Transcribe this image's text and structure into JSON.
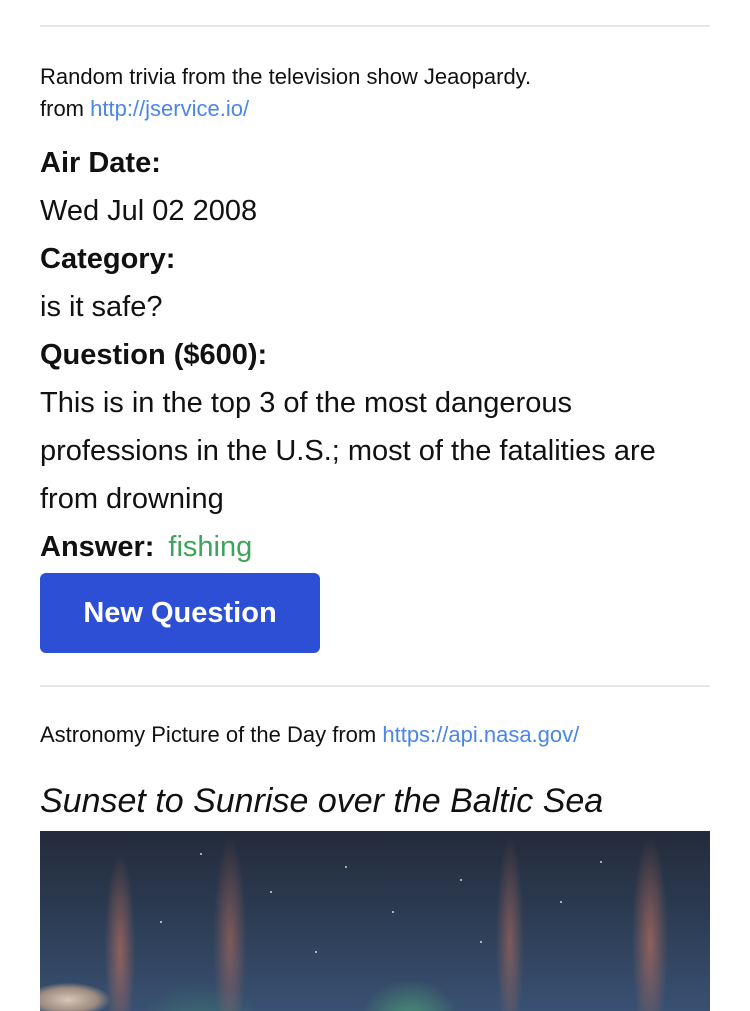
{
  "trivia": {
    "intro": "Random trivia from the television show Jeaopardy.",
    "from_label": "from",
    "source_link": "http://jservice.io/",
    "air_date_label": "Air Date:",
    "air_date": "Wed Jul 02 2008",
    "category_label": "Category:",
    "category": "is it safe?",
    "question_label": "Question ($600):",
    "question": "This is in the top 3 of the most dangerous professions in the U.S.; most of the fatalities are from drowning",
    "answer_label": "Answer:",
    "answer": "fishing",
    "new_question_button": "New Question"
  },
  "apod": {
    "source_text": "Astronomy Picture of the Day from",
    "source_link": "https://api.nasa.gov/",
    "title": "Sunset to Sunrise over the Baltic Sea",
    "image_description": "aurora-photo"
  },
  "colors": {
    "link": "#4a86e8",
    "answer": "#3fa45b",
    "button": "#2d4fd6"
  }
}
